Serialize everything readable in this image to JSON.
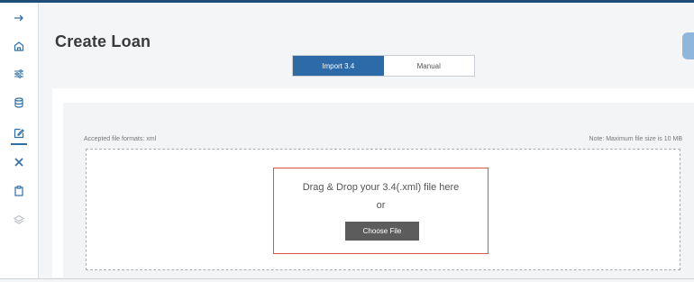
{
  "page": {
    "title": "Create Loan"
  },
  "sidebar": {
    "items": [
      {
        "icon": "arrow-right-icon"
      },
      {
        "icon": "home-icon"
      },
      {
        "icon": "sliders-icon"
      },
      {
        "icon": "database-icon"
      },
      {
        "icon": "edit-icon",
        "active": true
      },
      {
        "icon": "tools-icon"
      },
      {
        "icon": "clipboard-icon"
      },
      {
        "icon": "layers-icon",
        "disabled": true
      }
    ]
  },
  "mode_toggle": {
    "options": [
      {
        "label": "Import 3.4",
        "selected": true
      },
      {
        "label": "Manual",
        "selected": false
      }
    ]
  },
  "upload": {
    "accepted_formats": "Accepted file formats: xml",
    "note": "Note: Maximum file size is 10 MB",
    "drop_text": "Drag & Drop your 3.4(.xml) file here",
    "or_text": "or",
    "choose_button": "Choose File"
  },
  "colors": {
    "accent": "#2c6aa8",
    "highlight_border": "#d9534f",
    "button_dark": "#5c5c5c"
  }
}
